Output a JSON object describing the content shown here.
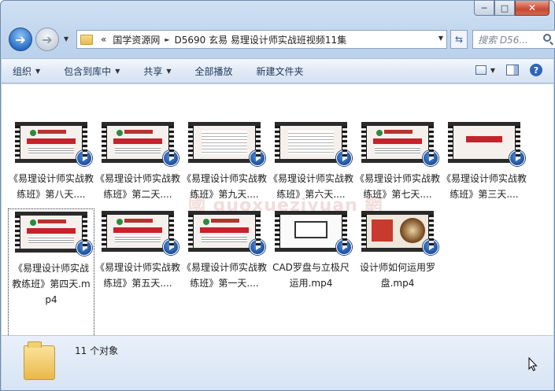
{
  "window": {
    "caption": {
      "minimize": "─",
      "maximize": "□",
      "close": "✕"
    }
  },
  "nav": {
    "back_icon": "back-arrow-icon",
    "forward_icon": "forward-arrow-icon",
    "breadcrumb_prefix": "«",
    "breadcrumbs": [
      "国学资源网",
      "D5690 玄易 易理设计师实战班视频11集"
    ],
    "search_placeholder": "搜索 D56..."
  },
  "toolbar": {
    "items": [
      "组织",
      "包含到库中",
      "共享",
      "全部播放",
      "新建文件夹"
    ],
    "has_arrow": [
      true,
      true,
      true,
      false,
      false
    ]
  },
  "files": [
    {
      "label": "《易理设计师实战教练班》第八天....",
      "thumb": "program"
    },
    {
      "label": "《易理设计师实战教练班》第二天....",
      "thumb": "program"
    },
    {
      "label": "《易理设计师实战教练班》第九天....",
      "thumb": "doc"
    },
    {
      "label": "《易理设计师实战教练班》第六天....",
      "thumb": "doc"
    },
    {
      "label": "《易理设计师实战教练班》第七天....",
      "thumb": "program"
    },
    {
      "label": "《易理设计师实战教练班》第三天....",
      "thumb": "title"
    },
    {
      "label": "《易理设计师实战教练班》第四天.mp4",
      "thumb": "program",
      "selected": true
    },
    {
      "label": "《易理设计师实战教练班》第五天....",
      "thumb": "program"
    },
    {
      "label": "《易理设计师实战教练班》第一天....",
      "thumb": "program"
    },
    {
      "label": "CAD罗盘与立极尺运用.mp4",
      "thumb": "cad"
    },
    {
      "label": "设计师如何运用罗盘.mp4",
      "thumb": "book"
    }
  ],
  "status": {
    "count": "11 个对象"
  }
}
